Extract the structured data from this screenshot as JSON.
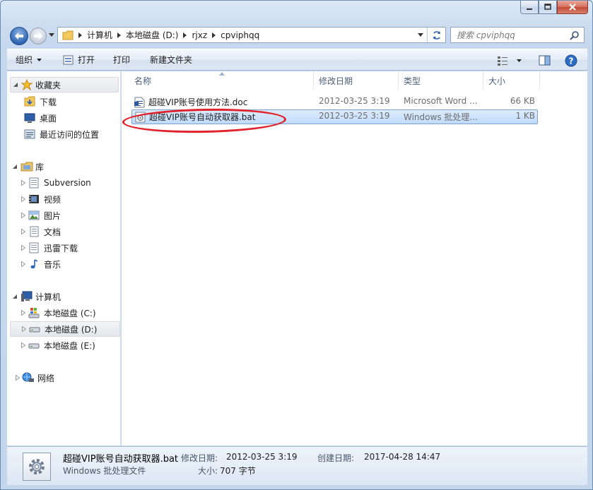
{
  "window": {
    "caption_buttons": [
      "minimize",
      "maximize",
      "close"
    ]
  },
  "address": {
    "breadcrumbs": [
      "计算机",
      "本地磁盘 (D:)",
      "rjxz",
      "cpviphqq"
    ]
  },
  "search": {
    "placeholder": "搜索 cpviphqq"
  },
  "toolbar": {
    "organize": "组织",
    "open": "打开",
    "print": "打印",
    "new_folder": "新建文件夹"
  },
  "sidebar": {
    "favorites": {
      "label": "收藏夹",
      "items": [
        "下载",
        "桌面",
        "最近访问的位置"
      ]
    },
    "libraries": {
      "label": "库",
      "items": [
        "Subversion",
        "视频",
        "图片",
        "文档",
        "迅雷下载",
        "音乐"
      ]
    },
    "computer": {
      "label": "计算机",
      "items": [
        "本地磁盘 (C:)",
        "本地磁盘 (D:)",
        "本地磁盘 (E:)"
      ],
      "selected": "本地磁盘 (D:)"
    },
    "network": {
      "label": "网络"
    }
  },
  "file_list": {
    "columns": [
      "名称",
      "修改日期",
      "类型",
      "大小"
    ],
    "rows": [
      {
        "name": "超碰VIP账号使用方法.doc",
        "modified": "2012-03-25 3:19",
        "type": "Microsoft Word ...",
        "size": "66 KB",
        "icon": "word-doc-icon",
        "selected": false
      },
      {
        "name": "超碰VIP账号自动获取器.bat",
        "modified": "2012-03-25 3:19",
        "type": "Windows 批处理...",
        "size": "1 KB",
        "icon": "batch-file-icon",
        "selected": true
      }
    ],
    "annotation_color": "#e0232c"
  },
  "details": {
    "name": "超碰VIP账号自动获取器.bat",
    "type": "Windows 批处理文件",
    "modified_label": "修改日期:",
    "modified": "2012-03-25 3:19",
    "created_label": "创建日期:",
    "created": "2017-04-28 14:47",
    "size_label": "大小:",
    "size": "707 字节"
  }
}
